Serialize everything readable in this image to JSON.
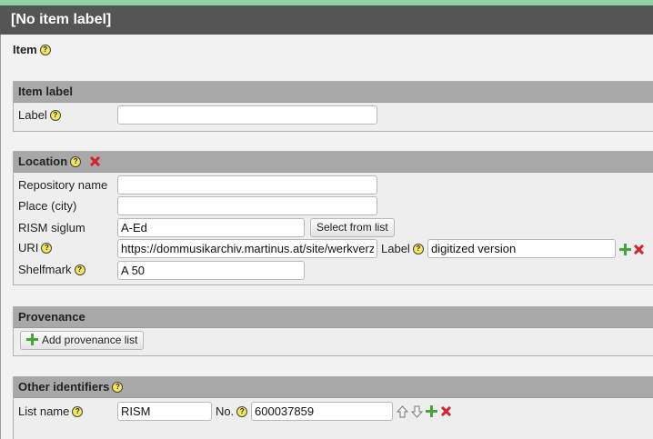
{
  "title": "[No item label]",
  "item_label": "Item",
  "sections": {
    "item_label": {
      "header": "Item label",
      "label_field": "Label",
      "label_value": ""
    },
    "location": {
      "header": "Location",
      "repository_name": {
        "label": "Repository name",
        "value": ""
      },
      "place": {
        "label": "Place (city)",
        "value": ""
      },
      "rism_siglum": {
        "label": "RISM siglum",
        "value": "A-Ed",
        "button": "Select from list"
      },
      "uri": {
        "label": "URI",
        "value": "https://dommusikarchiv.martinus.at/site/werkverz",
        "sublabel": "Label",
        "label_value": "digitized version"
      },
      "shelfmark": {
        "label": "Shelfmark",
        "value": "A 50"
      }
    },
    "provenance": {
      "header": "Provenance",
      "button": "Add provenance list"
    },
    "other_identifiers": {
      "header": "Other identifiers",
      "list_name": {
        "label": "List name",
        "value": "RISM"
      },
      "number": {
        "label": "No.",
        "value": "600037859"
      }
    }
  },
  "icons": {
    "help": "help-icon",
    "remove": "remove-icon",
    "add": "add-icon",
    "up": "arrow-up-icon",
    "down": "arrow-down-icon"
  },
  "colors": {
    "title_bar": "#555555",
    "section_header": "#a8a8a8",
    "remove": "#d3232e",
    "add": "#44a63a",
    "help": "#f4e85a"
  }
}
